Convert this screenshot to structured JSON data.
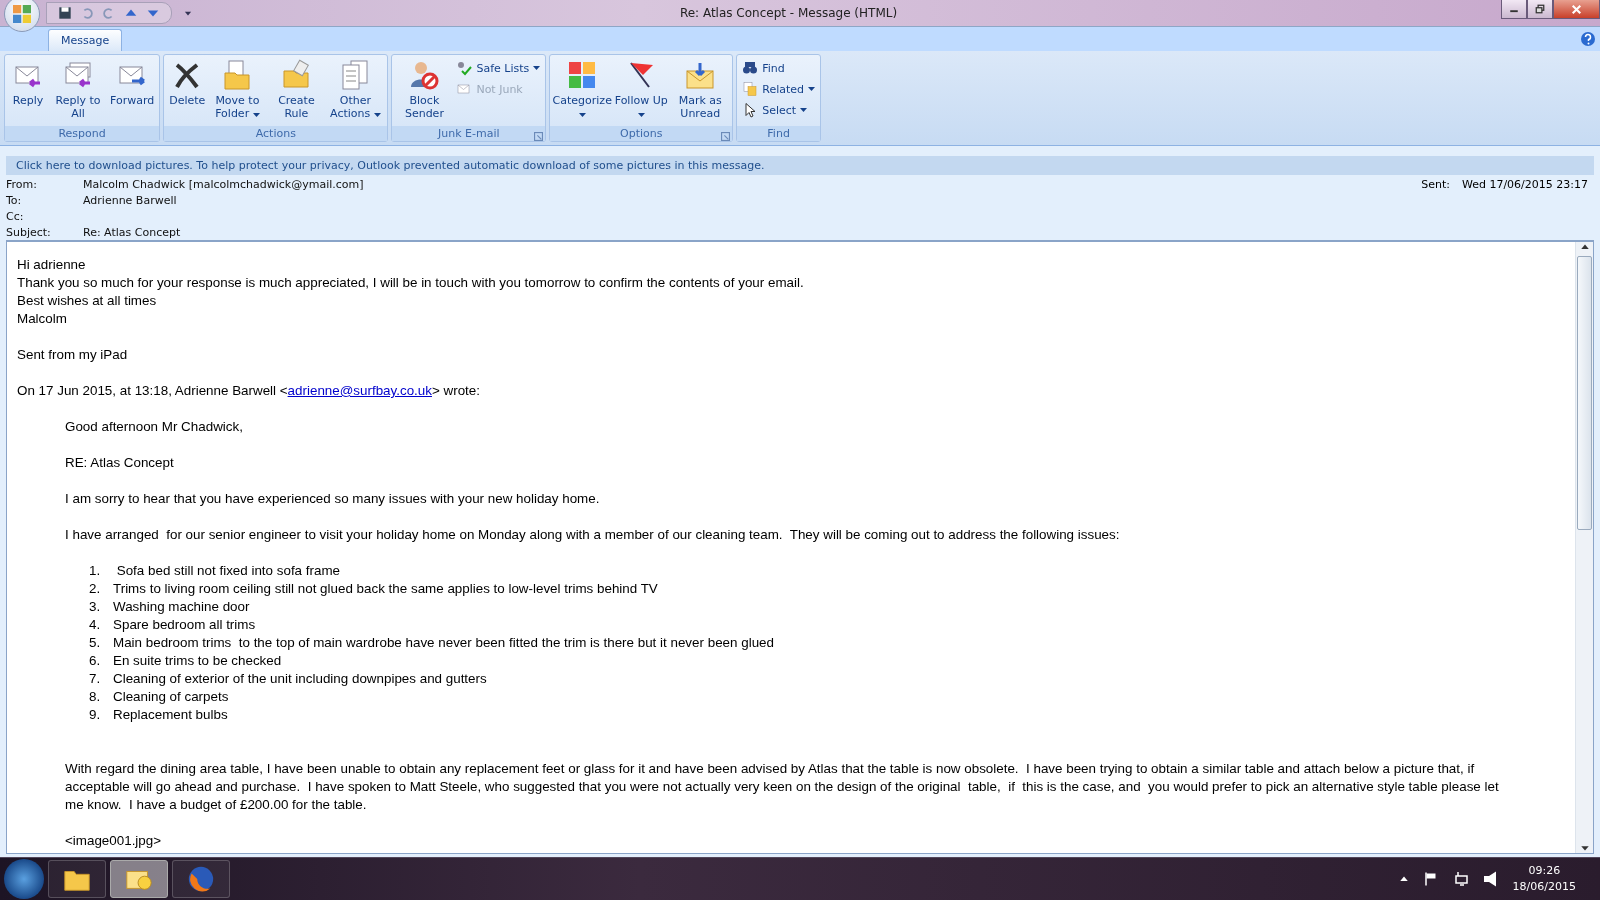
{
  "window": {
    "title": "Re: Atlas Concept  - Message (HTML)"
  },
  "tabs": [
    {
      "label": "Message",
      "selected": true
    }
  ],
  "ribbon": [
    {
      "label": "Respond",
      "launcher": false,
      "buttons": [
        {
          "kind": "large",
          "label": "Reply",
          "disabled": false,
          "menu": false
        },
        {
          "kind": "large",
          "label": "Reply to All",
          "disabled": false,
          "menu": false
        },
        {
          "kind": "large",
          "label": "Forward",
          "disabled": false,
          "menu": false
        }
      ]
    },
    {
      "label": "Actions",
      "launcher": false,
      "buttons": [
        {
          "kind": "large",
          "label": "Delete",
          "disabled": false,
          "menu": false
        },
        {
          "kind": "large",
          "label": "Move to Folder",
          "disabled": false,
          "menu": true
        },
        {
          "kind": "large",
          "label": "Create Rule",
          "disabled": false,
          "menu": false
        },
        {
          "kind": "large",
          "label": "Other Actions",
          "disabled": false,
          "menu": true
        }
      ]
    },
    {
      "label": "Junk E-mail",
      "launcher": true,
      "buttons": [
        {
          "kind": "large",
          "label": "Block Sender",
          "disabled": false,
          "menu": false
        },
        {
          "kind": "small",
          "label": "Safe Lists",
          "disabled": false,
          "menu": true
        },
        {
          "kind": "small",
          "label": "Not Junk",
          "disabled": true,
          "menu": false
        }
      ]
    },
    {
      "label": "Options",
      "launcher": true,
      "buttons": [
        {
          "kind": "large",
          "label": "Categorize",
          "disabled": false,
          "menu": true
        },
        {
          "kind": "large",
          "label": "Follow Up",
          "disabled": false,
          "menu": true
        },
        {
          "kind": "large",
          "label": "Mark as Unread",
          "disabled": false,
          "menu": false
        }
      ]
    },
    {
      "label": "Find",
      "launcher": false,
      "buttons": [
        {
          "kind": "small",
          "label": "Find",
          "disabled": false,
          "menu": false
        },
        {
          "kind": "small",
          "label": "Related",
          "disabled": false,
          "menu": true
        },
        {
          "kind": "small",
          "label": "Select",
          "disabled": false,
          "menu": true
        }
      ]
    }
  ],
  "infobar": "Click here to download pictures. To help protect your privacy, Outlook prevented automatic download of some pictures in this message.",
  "headers": [
    {
      "label": "From:",
      "value": "Malcolm Chadwick [malcolmchadwick@ymail.com]"
    },
    {
      "label": "To:",
      "value": "Adrienne Barwell"
    },
    {
      "label": "Cc:"
    },
    {
      "label": "Subject:",
      "value": "Re: Atlas Concept"
    }
  ],
  "sent": {
    "label": "Sent:",
    "value": "Wed 17/06/2015 23:17"
  },
  "body": {
    "blocks": [
      [
        "Hi adrienne",
        "Thank you so much for your response is much appreciated, I will be in touch with you tomorrow to confirm the contents of your email.",
        "Best wishes at all times",
        "Malcolm"
      ],
      [
        "Sent from my iPad"
      ]
    ],
    "quote_header": {
      "before": "On 17 Jun 2015, at 13:18, Adrienne Barwell <",
      "link": "adrienne@surfbay.co.uk",
      "after": "> wrote:"
    },
    "quoted": [
      {
        "kind": "para",
        "text": "Good afternoon Mr Chadwick,"
      },
      {
        "kind": "para",
        "text": "RE: Atlas Concept"
      },
      {
        "kind": "para",
        "text": "I am sorry to hear that you have experienced so many issues with your new holiday home."
      },
      {
        "kind": "para",
        "text": "I have arranged  for our senior engineer to visit your holiday home on Monday along with a member of our cleaning team.  They will be coming out to address the following issues:"
      },
      {
        "kind": "list",
        "items": [
          {
            "number": "1.",
            "text": " Sofa bed still not fixed into sofa frame"
          },
          {
            "number": "2.",
            "text": "Trims to living room ceiling still not glued back the same applies to low-level trims behind TV"
          },
          {
            "number": "3.",
            "text": "Washing machine door"
          },
          {
            "number": "4.",
            "text": "Spare bedroom all trims"
          },
          {
            "number": "5.",
            "text": "Main bedroom trims  to the top of main wardrobe have never been fitted the trim is there but it never been glued"
          },
          {
            "number": "6.",
            "text": "En suite trims to be checked"
          },
          {
            "number": "7.",
            "text": "Cleaning of exterior of the unit including downpipes and gutters"
          },
          {
            "number": "8.",
            "text": "Cleaning of carpets"
          },
          {
            "number": "9.",
            "text": "Replacement bulbs"
          }
        ]
      },
      {
        "kind": "gap"
      },
      {
        "kind": "para",
        "text": "With regard the dining area table, I have been unable to obtain any replacement feet or glass for it and have been advised by Atlas that the table is now obsolete.  I have been trying to obtain a similar table and attach below a picture that, if acceptable will go ahead and purchase.  I have spoken to Matt Steele, who suggested that you were not actually very keen on the design of the original  table,  if  this is the case, and  you would prefer to pick an alternative style table please let me know.  I have a budget of £200.00 for the table."
      },
      {
        "kind": "para",
        "text": "<image001.jpg>"
      }
    ]
  },
  "taskbar": {
    "apps": [
      {
        "selected": false
      },
      {
        "selected": true
      },
      {
        "selected": false
      }
    ],
    "time": "09:26",
    "date": "18/06/2015"
  }
}
